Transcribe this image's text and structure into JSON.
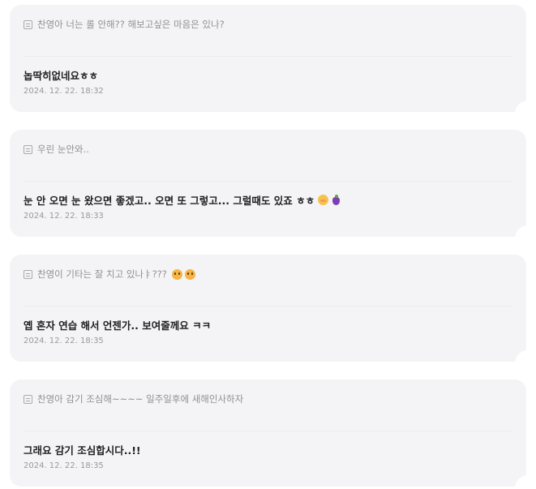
{
  "entries": [
    {
      "question": "찬영아 너는 롤 안해?? 해보고싶은 마음은 있나?",
      "answer": "놉딱히없네요ㅎㅎ",
      "date": "2024. 12. 22. 18:32"
    },
    {
      "question": "우린 눈안와..",
      "answer": "눈 안 오면 눈 왔으면 좋겠고.. 오면 또 그렇고... 그럴때도 있죠 ㅎㅎ",
      "answer_emojis": [
        "blush-face-emoji",
        "grapes-emoji"
      ],
      "date": "2024. 12. 22. 18:33"
    },
    {
      "question": "찬영이 기타는 잘 치고 있나ㅑ???",
      "question_emojis": [
        "pleading-face-emoji",
        "pleading-face-emoji"
      ],
      "answer": "옙 혼자 연습 해서 언젠가.. 보여줄께요 ㅋㅋ",
      "date": "2024. 12. 22. 18:35"
    },
    {
      "question": "찬영아 감기 조심해~~~~ 일주일후에 새해인사하자",
      "answer": "그래요 감기 조심합시다..!!",
      "date": "2024. 12. 22. 18:35"
    }
  ],
  "colors": {
    "card_bg": "#f4f4f6",
    "question_text": "#8f8f96",
    "answer_text": "#1f1f24",
    "date_text": "#98989f"
  },
  "icons": {
    "question_marker": "memo-icon"
  }
}
